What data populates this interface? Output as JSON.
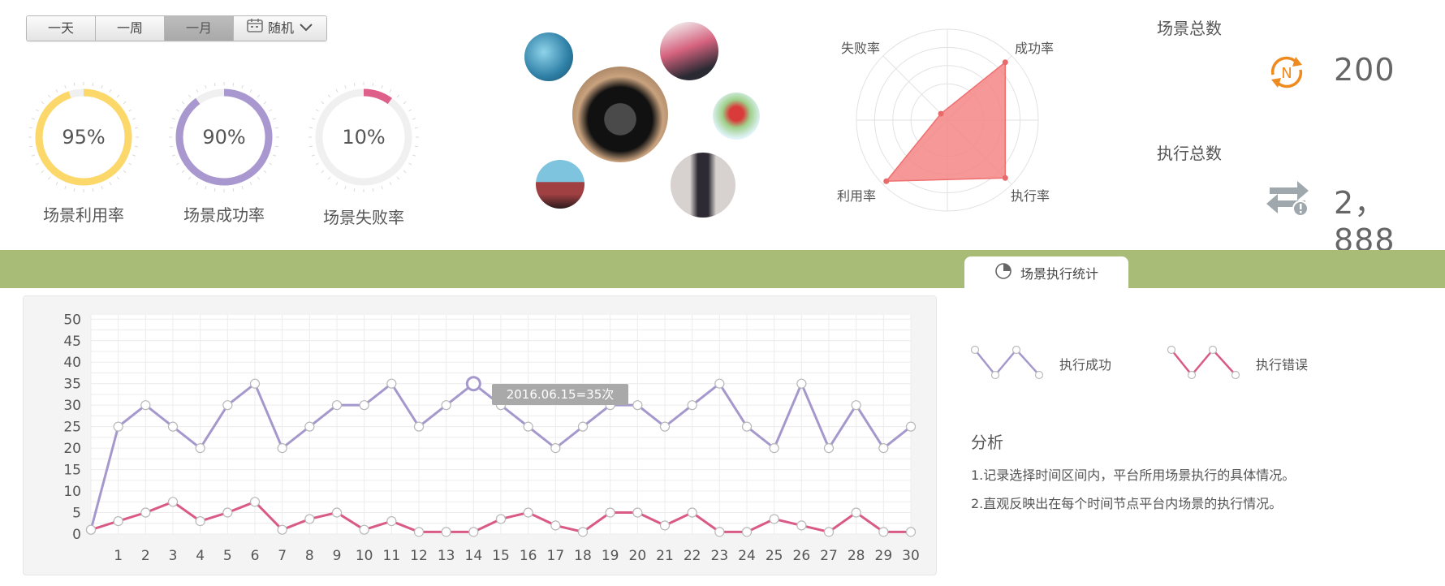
{
  "range_selector": {
    "options": [
      "一天",
      "一周",
      "一月"
    ],
    "selected": "一月",
    "random_label": "随机"
  },
  "gauges": [
    {
      "value_text": "95%",
      "value": 95,
      "label": "场景利用率",
      "color": "#fcd86a"
    },
    {
      "value_text": "90%",
      "value": 90,
      "label": "场景成功率",
      "color": "#a997cf"
    },
    {
      "value_text": "10%",
      "value": 10,
      "label": "场景失败率",
      "color": "#dd5f8a"
    }
  ],
  "radar": {
    "axes": [
      "成功率",
      "执行率",
      "利用率",
      "失败率"
    ],
    "values": [
      0.9,
      0.9,
      0.95,
      0.1
    ],
    "fill_color": "#f58686"
  },
  "totals": {
    "scenes_title": "场景总数",
    "scenes_value": "200",
    "executions_title": "执行总数",
    "executions_value": "2，888"
  },
  "tab": {
    "label": "场景执行统计"
  },
  "chart_data": {
    "type": "line",
    "x": [
      0,
      1,
      2,
      3,
      4,
      5,
      6,
      7,
      8,
      9,
      10,
      11,
      12,
      13,
      14,
      15,
      16,
      17,
      18,
      19,
      20,
      21,
      22,
      23,
      24,
      25,
      26,
      27,
      28,
      29,
      30
    ],
    "x_tick_labels": [
      "1",
      "2",
      "3",
      "4",
      "5",
      "6",
      "7",
      "8",
      "9",
      "10",
      "11",
      "12",
      "13",
      "14",
      "15",
      "16",
      "17",
      "18",
      "19",
      "20",
      "21",
      "22",
      "23",
      "24",
      "25",
      "26",
      "27",
      "28",
      "29",
      "30"
    ],
    "y_ticks": [
      0,
      5,
      10,
      15,
      20,
      25,
      30,
      35,
      40,
      45,
      50
    ],
    "ylim": [
      0,
      51
    ],
    "series": [
      {
        "name": "执行成功",
        "color": "#a598cc",
        "values": [
          1,
          25,
          30,
          25,
          20,
          30,
          35,
          20,
          25,
          30,
          30,
          35,
          25,
          30,
          35,
          30,
          25,
          20,
          25,
          30,
          30,
          25,
          30,
          35,
          25,
          20,
          35,
          20,
          30,
          20,
          25
        ]
      },
      {
        "name": "执行错误",
        "color": "#d95a86",
        "values": [
          1,
          3,
          5,
          7.5,
          3,
          5,
          7.5,
          1,
          3.5,
          5,
          1,
          3,
          0.5,
          0.5,
          0.5,
          3.5,
          5,
          2,
          0.5,
          5,
          5,
          2,
          5,
          0.5,
          0.5,
          3.5,
          2,
          0.5,
          5,
          0.5,
          0.5
        ]
      }
    ],
    "tooltip": "2016.06.15=35次",
    "grid": true
  },
  "legend": {
    "success_label": "执行成功",
    "error_label": "执行错误"
  },
  "analysis": {
    "title": "分析",
    "notes": [
      "1.记录选择时间区间内，平台所用场景执行的具体情况。",
      "2.直观反映出在每个时间节点平台内场景的执行情况。"
    ]
  }
}
